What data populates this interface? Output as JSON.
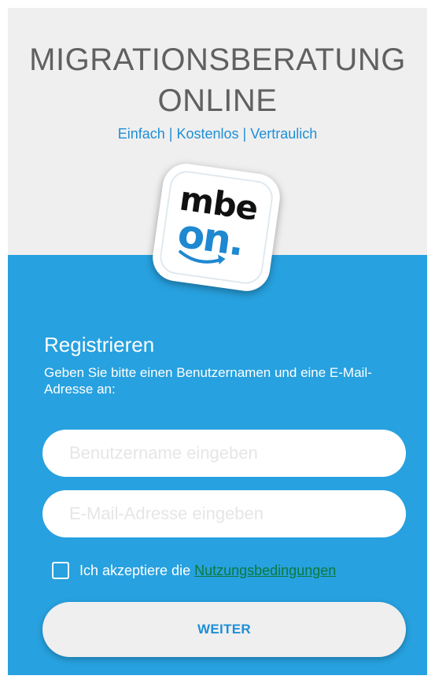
{
  "header": {
    "title_line1": "MIGRATIONSBERATUNG",
    "title_line2": "ONLINE",
    "tagline": "Einfach | Kostenlos | Vertraulich"
  },
  "logo": {
    "text_top": "mbe",
    "text_bottom": "on."
  },
  "register": {
    "title": "Registrieren",
    "description": "Geben Sie bitte einen Benutzernamen und eine E-Mail-Adresse an:"
  },
  "form": {
    "username": {
      "value": "",
      "placeholder": "Benutzername eingeben"
    },
    "email": {
      "value": "",
      "placeholder": "E-Mail-Adresse eingeben"
    },
    "terms_prefix": "Ich akzeptiere die",
    "terms_link": "Nutzungsbedingungen",
    "terms_checked": false,
    "submit_label": "WEITER"
  },
  "colors": {
    "top_background": "#efefef",
    "bottom_background": "#27a1df",
    "accent_blue": "#1e8fd5",
    "title_gray": "#606060",
    "link_green": "#0b7a3a"
  },
  "icons": {
    "logo": "mbe-on-logo",
    "checkbox": "checkbox-unchecked-icon",
    "arrow": "swoosh-arrow-icon"
  }
}
